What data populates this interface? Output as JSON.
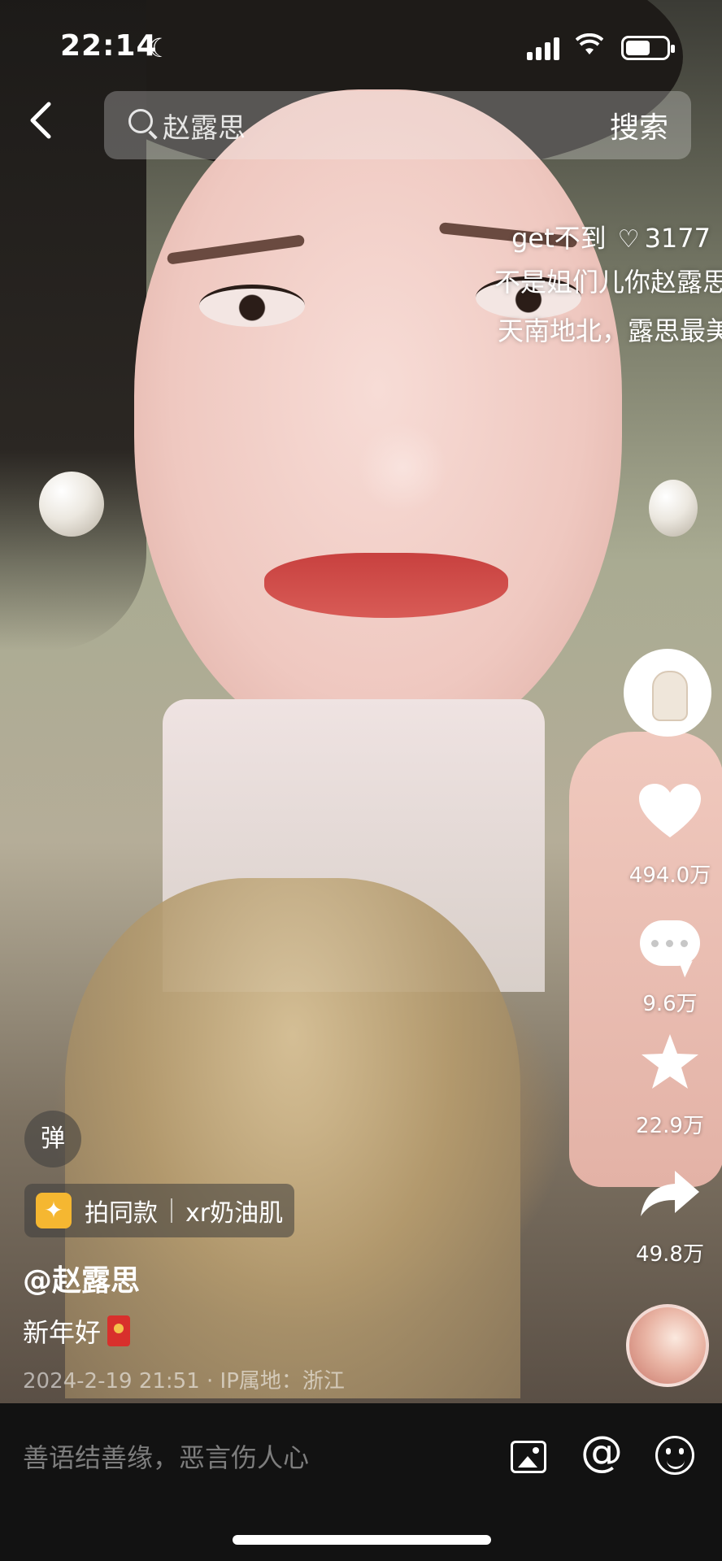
{
  "status_bar": {
    "time": "22:14",
    "moon_icon": "moon-icon",
    "signal_icon": "signal-icon",
    "wifi_icon": "wifi-icon",
    "battery_icon": "battery-icon",
    "battery_level": 0.6
  },
  "header": {
    "back_icon": "chevron-left-icon",
    "search": {
      "icon": "search-icon",
      "query": "赵露思",
      "button_label": "搜索"
    }
  },
  "danmaku": [
    {
      "text": "get不到",
      "likes": "3177"
    },
    {
      "text": "不是姐们儿你赵露思"
    },
    {
      "text": "天南地北，露思最美"
    }
  ],
  "actions": {
    "like": {
      "icon": "heart-icon",
      "count": "494.0万"
    },
    "comment": {
      "icon": "comment-icon",
      "count": "9.6万"
    },
    "favorite": {
      "icon": "star-icon",
      "count": "22.9万"
    },
    "share": {
      "icon": "share-icon",
      "count": "49.8万"
    }
  },
  "video_info": {
    "bullet_toggle_label": "弹",
    "effect_tag": {
      "label": "拍同款",
      "sub_label": "xr奶油肌"
    },
    "author": "@赵露思",
    "caption": "新年好",
    "meta": "2024-2-19 21:51 · IP属地：浙江"
  },
  "bottom_bar": {
    "comment_placeholder": "善语结善缘，恶言伤人心",
    "image_icon": "image-icon",
    "mention_icon": "at-icon",
    "emoji_icon": "emoji-icon"
  },
  "colors": {
    "bottom_bar_bg": "#121212",
    "placeholder_text": "#7d7d7d",
    "tag_icon_bg": "#f5b731",
    "red_envelope": "#d8302c"
  }
}
